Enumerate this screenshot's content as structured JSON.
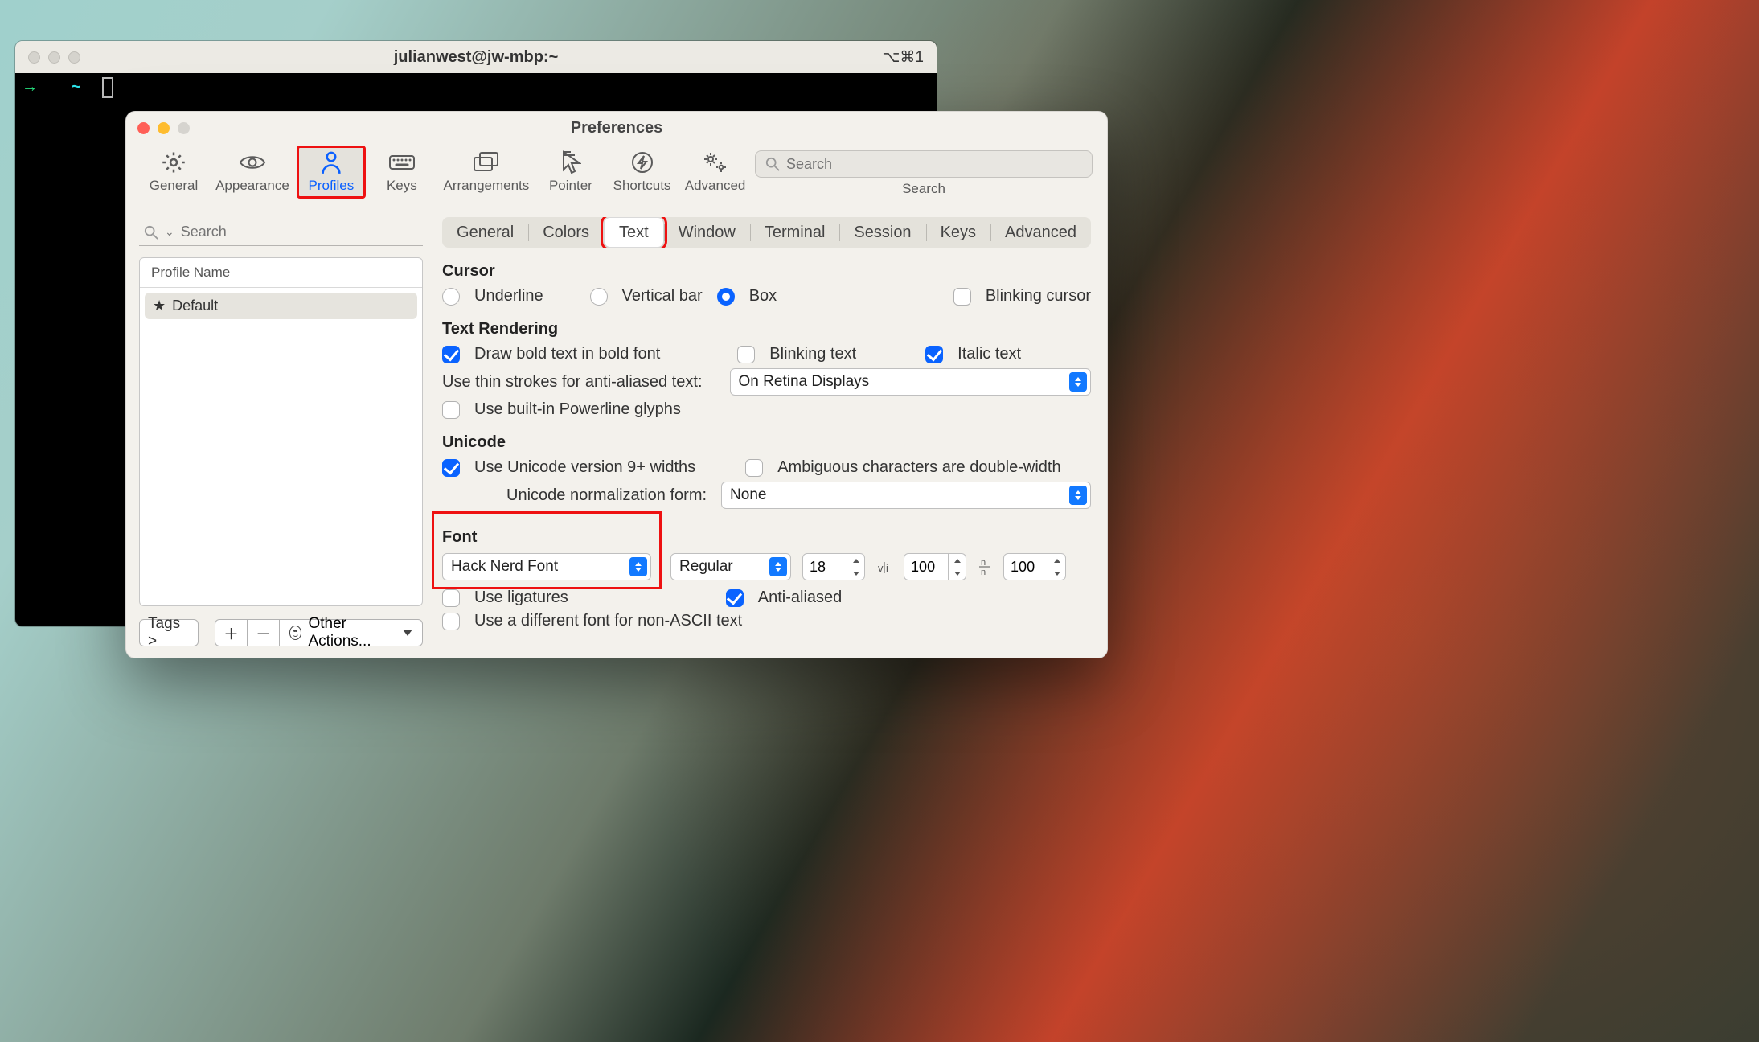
{
  "terminal": {
    "title": "julianwest@jw-mbp:~",
    "session_indicator": "⌥⌘1"
  },
  "prefs": {
    "title": "Preferences",
    "toolbar": {
      "general": "General",
      "appearance": "Appearance",
      "profiles": "Profiles",
      "keys": "Keys",
      "arrangements": "Arrangements",
      "pointer": "Pointer",
      "shortcuts": "Shortcuts",
      "advanced": "Advanced",
      "search_placeholder": "Search",
      "search_label": "Search"
    },
    "sidebar": {
      "search_placeholder": "Search",
      "header": "Profile Name",
      "profile": "Default",
      "tags_btn": "Tags >",
      "other_actions": "Other Actions..."
    },
    "subtabs": {
      "general": "General",
      "colors": "Colors",
      "text": "Text",
      "window": "Window",
      "terminal": "Terminal",
      "session": "Session",
      "keys": "Keys",
      "advanced": "Advanced"
    },
    "text": {
      "cursor_title": "Cursor",
      "underline": "Underline",
      "vertical": "Vertical bar",
      "box": "Box",
      "blinking_cursor": "Blinking cursor",
      "rendering_title": "Text Rendering",
      "bold_bold": "Draw bold text in bold font",
      "blinking_text": "Blinking text",
      "italic": "Italic text",
      "thin_strokes_label": "Use thin strokes for anti-aliased text:",
      "thin_strokes_value": "On Retina Displays",
      "builtin_powerline": "Use built-in Powerline glyphs",
      "unicode_title": "Unicode",
      "unicode9": "Use Unicode version 9+ widths",
      "ambiguous": "Ambiguous characters are double-width",
      "normalization_label": "Unicode normalization form:",
      "normalization_value": "None",
      "font_title": "Font",
      "font_name": "Hack Nerd Font",
      "font_weight": "Regular",
      "font_size": "18",
      "hspacing": "100",
      "vspacing": "100",
      "ligatures": "Use ligatures",
      "antialiased": "Anti-aliased",
      "diff_font": "Use a different font for non-ASCII text"
    }
  }
}
